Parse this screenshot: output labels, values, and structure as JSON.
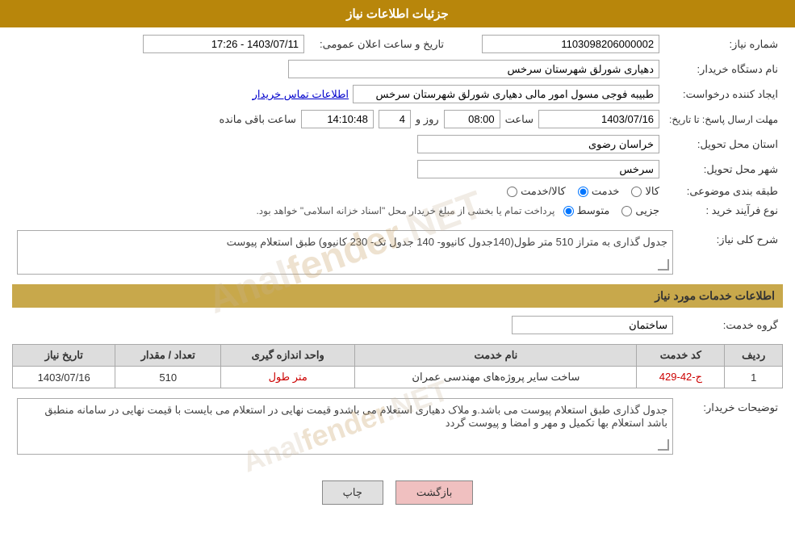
{
  "header": {
    "title": "جزئیات اطلاعات نیاز"
  },
  "fields": {
    "shomara_niaz_label": "شماره نیاز:",
    "shomara_niaz_value": "1103098206000002",
    "namdastgah_label": "نام دستگاه خریدار:",
    "namdastgah_value": "دهیاری شورلق شهرستان سرخس",
    "idad_label": "ایجاد کننده درخواست:",
    "idad_value": "طبیبه فوجی مسول امور مالی دهیاری شورلق شهرستان سرخس",
    "etelaat_label": "اطلاعات تماس خریدار",
    "mohlat_label": "مهلت ارسال پاسخ: تا تاریخ:",
    "tarikh_label": "تاریخ و ساعت اعلان عمومی:",
    "tarikh_value": "1403/07/11 - 17:26",
    "mohlat_tarikh": "1403/07/16",
    "mohlat_saat": "08:00",
    "mohlat_roz": "4",
    "mohlat_baqi": "14:10:48",
    "ostan_label": "استان محل تحویل:",
    "ostan_value": "خراسان رضوی",
    "shahr_label": "شهر محل تحویل:",
    "shahr_value": "سرخس",
    "tabaqe_label": "طبقه بندی موضوعی:",
    "tabaqe_options": [
      "کالا",
      "خدمت",
      "کالا/خدمت"
    ],
    "tabaqe_selected": "خدمت",
    "noefrayand_label": "نوع فرآیند خرید :",
    "noefrayand_options": [
      "جزیی",
      "متوسط"
    ],
    "noefrayand_selected": "متوسط",
    "noefrayand_note": "پرداخت تمام یا بخشی از مبلغ خریدار محل \"اسناد خزانه اسلامی\" خواهد بود.",
    "sharh_label": "شرح کلی نیاز:",
    "sharh_value": "جدول گذاری به متراز 510 متر طول(140جدول کانیوو- 140 جدول تک- 230 کانیوو) طبق استعلام پیوست",
    "services_section": "اطلاعات خدمات مورد نیاز",
    "grohe_label": "گروه خدمت:",
    "grohe_value": "ساختمان",
    "table_headers": [
      "ردیف",
      "کد خدمت",
      "نام خدمت",
      "واحد اندازه گیری",
      "تعداد / مقدار",
      "تاریخ نیاز"
    ],
    "table_rows": [
      {
        "radif": "1",
        "code": "ج-42-429",
        "name": "ساخت سایر پروژه‌های مهندسی عمران",
        "unit": "متر طول",
        "count": "510",
        "date": "1403/07/16"
      }
    ],
    "tozihat_label": "توضیحات خریدار:",
    "tozihat_value": "جدول گذاری طبق استعلام پیوست می باشد.و ملاک  دهیاری استعلام  می باشدو قیمت نهایی در استعلام می بایست با قیمت  نهایی در سامانه  منطبق باشد استعلام  بها  تکمیل  و مهر و امضا و پیوست  گردد"
  },
  "buttons": {
    "print_label": "چاپ",
    "back_label": "بازگشت"
  }
}
